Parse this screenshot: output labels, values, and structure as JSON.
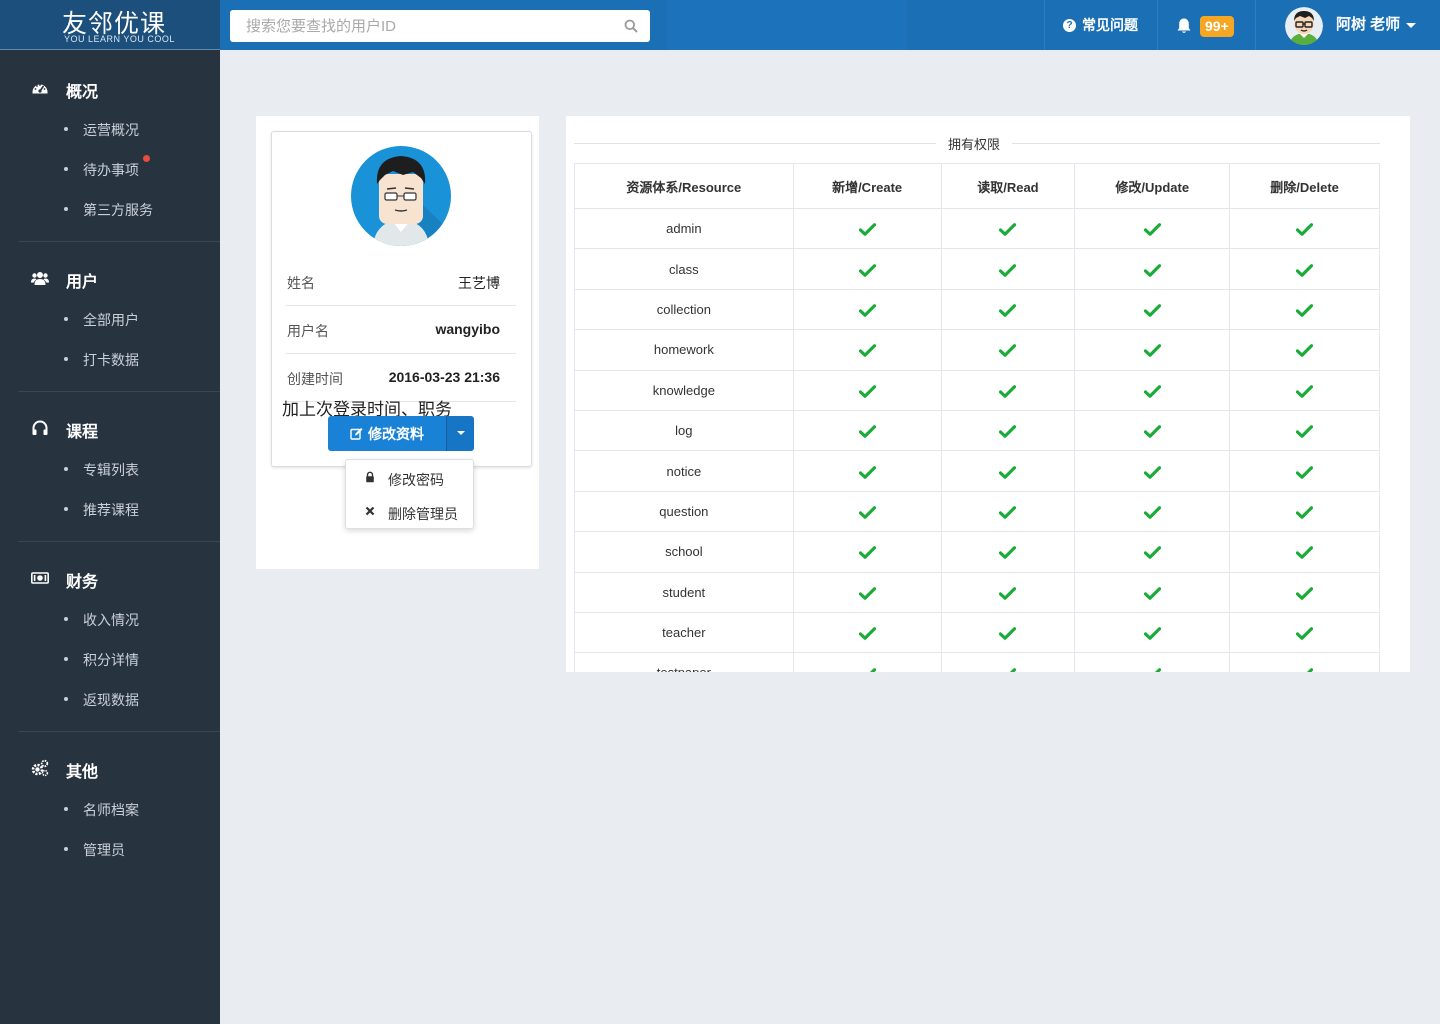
{
  "header": {
    "logo_cn": "友邻优课",
    "logo_en": "YOU LEARN YOU COOL",
    "search_placeholder": "搜索您要查找的用户ID",
    "faq_label": "常见问题",
    "notification_count": "99+",
    "user_name": "阿树 老师"
  },
  "sidebar": {
    "groups": [
      {
        "label": "概况",
        "icon": "dashboard-icon",
        "items": [
          "运营概况",
          "待办事项",
          "第三方服务"
        ]
      },
      {
        "label": "用户",
        "icon": "users-icon",
        "items": [
          "全部用户",
          "打卡数据"
        ]
      },
      {
        "label": "课程",
        "icon": "headphones-icon",
        "items": [
          "专辑列表",
          "推荐课程"
        ]
      },
      {
        "label": "财务",
        "icon": "money-icon",
        "items": [
          "收入情况",
          "积分详情",
          "返现数据"
        ]
      },
      {
        "label": "其他",
        "icon": "gears-icon",
        "items": [
          "名师档案",
          "管理员"
        ]
      }
    ]
  },
  "profile": {
    "name_key": "姓名",
    "name_val": "王艺博",
    "username_key": "用户名",
    "username_val": "wangyibo",
    "created_key": "创建时间",
    "created_val": "2016-03-23 21:36",
    "note": "加上次登录时间、职务",
    "edit_label": "修改资料",
    "menu": {
      "change_password": "修改密码",
      "delete_admin": "删除管理员"
    }
  },
  "permissions": {
    "title": "拥有权限",
    "columns": [
      "资源体系/Resource",
      "新增/Create",
      "读取/Read",
      "修改/Update",
      "删除/Delete"
    ],
    "rows": [
      "admin",
      "class",
      "collection",
      "homework",
      "knowledge",
      "log",
      "notice",
      "question",
      "school",
      "student",
      "teacher",
      "testpaper"
    ]
  },
  "colors": {
    "header": "#1a6fb5",
    "sidebar": "#283340",
    "primary_button": "#1a82d6",
    "check": "#1aab39",
    "badge": "#f5a623"
  }
}
